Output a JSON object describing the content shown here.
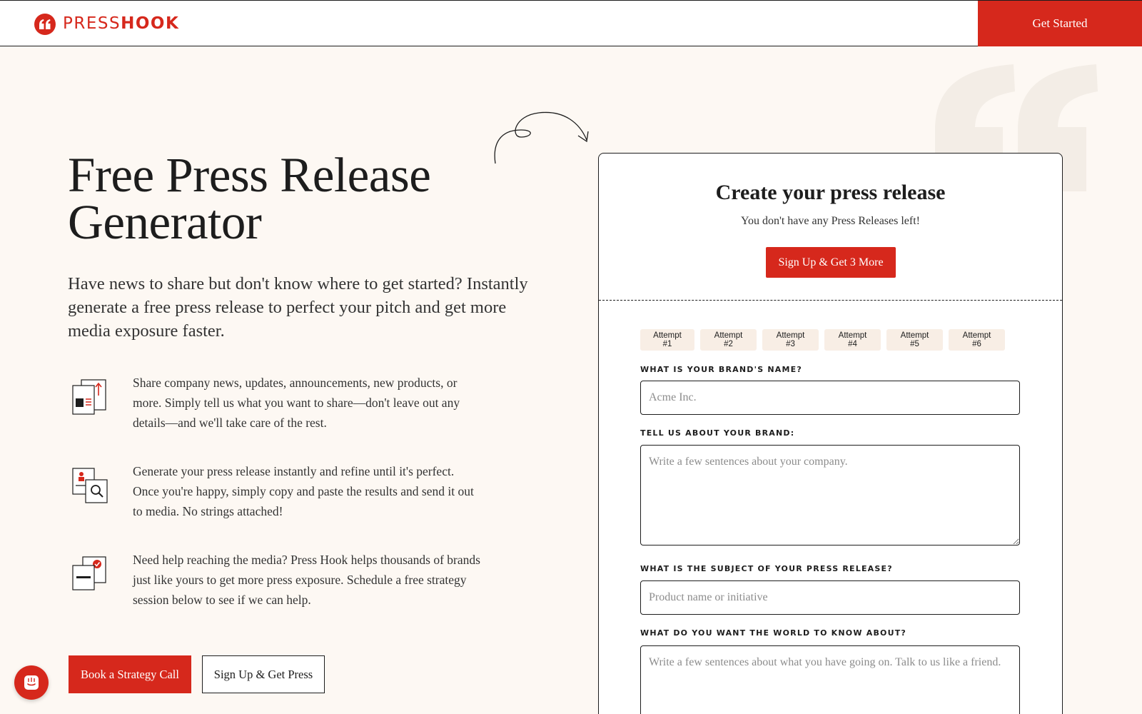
{
  "header": {
    "logo_press": "PRESS",
    "logo_hook": "HOOK",
    "get_started_label": "Get Started"
  },
  "hero": {
    "title_line1": "Free Press Release",
    "title_line2": "Generator",
    "subtitle": "Have news to share but don't know where to get started? Instantly generate a free press release to perfect your pitch and get more media exposure faster."
  },
  "features": [
    {
      "icon": "news-upload-icon",
      "text": "Share company news, updates, announcements, new products, or more. Simply tell us what you want to share—don't leave out any details—and we'll take care of the rest."
    },
    {
      "icon": "search-document-icon",
      "text": "Generate your press release instantly and refine until it's perfect. Once you're happy, simply copy and paste the results and send it out to media. No strings attached!"
    },
    {
      "icon": "media-check-icon",
      "text": "Need help reaching the media? Press Hook helps thousands of brands just like yours to get more press exposure. Schedule a free strategy session below to see if we can help."
    }
  ],
  "cta": {
    "primary_label": "Book a Strategy Call",
    "secondary_label": "Sign Up & Get Press"
  },
  "card": {
    "title": "Create your press release",
    "subtitle": "You don't have any Press Releases left!",
    "signup_label": "Sign Up & Get 3 More",
    "attempts": [
      "Attempt #1",
      "Attempt #2",
      "Attempt #3",
      "Attempt #4",
      "Attempt #5",
      "Attempt #6"
    ],
    "fields": {
      "brand_name": {
        "label": "WHAT IS YOUR BRAND'S NAME?",
        "placeholder": "Acme Inc.",
        "value": ""
      },
      "brand_about": {
        "label": "TELL US ABOUT YOUR BRAND:",
        "placeholder": "Write a few sentences about your company.",
        "value": ""
      },
      "subject": {
        "label": "WHAT IS THE SUBJECT OF YOUR PRESS RELEASE?",
        "placeholder": "Product name or initiative",
        "value": ""
      },
      "world_know": {
        "label": "WHAT DO YOU WANT THE WORLD TO KNOW ABOUT?",
        "placeholder": "Write a few sentences about what you have going on. Talk to us like a friend.",
        "value": ""
      }
    }
  },
  "colors": {
    "brand_red": "#d6281c",
    "background": "#fdf8f3",
    "attempt_bg": "#f8eee5",
    "text": "#1d1d1d"
  },
  "chat_widget": {
    "icon": "chat-icon"
  }
}
